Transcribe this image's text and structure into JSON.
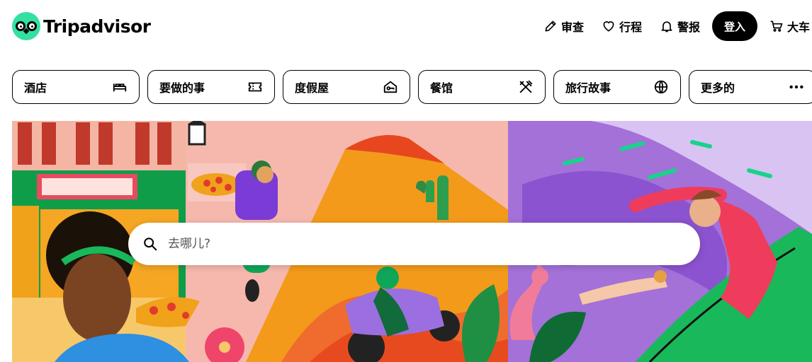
{
  "brand": {
    "name": "Tripadvisor",
    "color": "#34e0a1"
  },
  "nav": {
    "review_label": "审查",
    "trips_label": "行程",
    "alerts_label": "警报",
    "login_label": "登入",
    "cart_label": "大车"
  },
  "tabs": [
    {
      "label": "酒店",
      "icon": "bed-icon"
    },
    {
      "label": "要做的事",
      "icon": "ticket-icon"
    },
    {
      "label": "度假屋",
      "icon": "house-key-icon"
    },
    {
      "label": "餐馆",
      "icon": "fork-knife-icon"
    },
    {
      "label": "旅行故事",
      "icon": "globe-icon"
    },
    {
      "label": "更多的",
      "icon": "more-dots-icon"
    }
  ],
  "search": {
    "placeholder": "去哪儿?"
  }
}
